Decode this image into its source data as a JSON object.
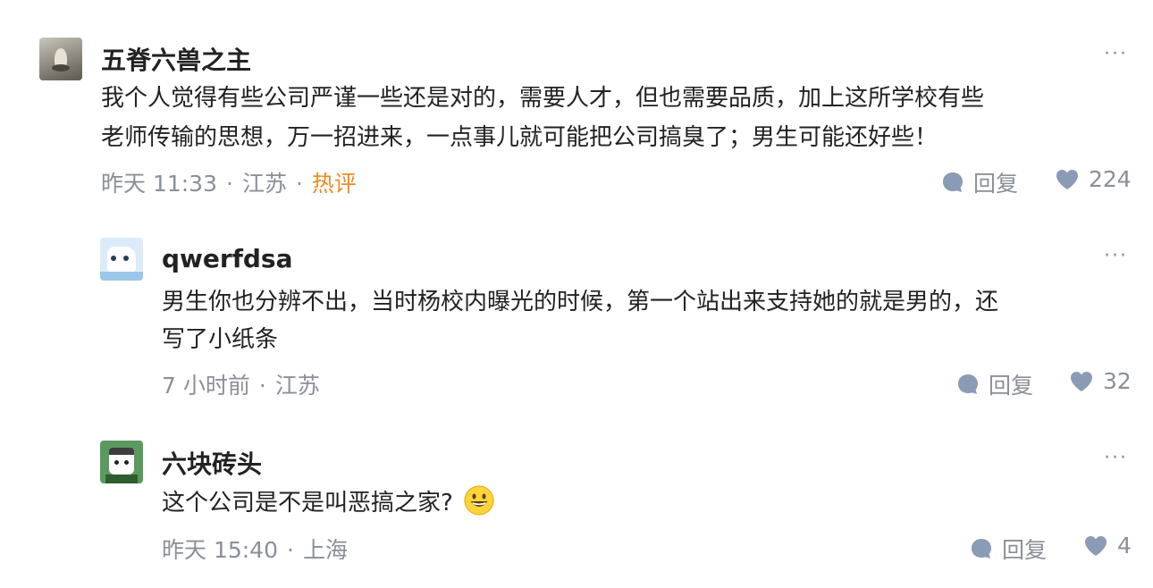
{
  "comments": [
    {
      "user": "五脊六兽之主",
      "text_line1": "我个人觉得有些公司严谨一些还是对的，需要人才，但也需要品质，加上这所学校有些",
      "text_line2": "老师传输的思想，万一招进来，一点事儿就可能把公司搞臭了；男生可能还好些！",
      "time": "昨天 11:33",
      "location": "江苏",
      "badge": "热评",
      "reply_label": "回复",
      "likes": "224",
      "more": "···"
    },
    {
      "user": "qwerfdsa",
      "text_line1": "男生你也分辨不出，当时杨校内曝光的时候，第一个站出来支持她的就是男的，还",
      "text_line2": "写了小纸条",
      "time": "7 小时前",
      "location": "江苏",
      "reply_label": "回复",
      "likes": "32",
      "more": "···"
    },
    {
      "user": "六块砖头",
      "text_line1": "这个公司是不是叫恶搞之家?",
      "emoji": "grinning-face-emoji",
      "time": "昨天 15:40",
      "location": "上海",
      "reply_label": "回复",
      "likes": "4",
      "more": "···"
    }
  ],
  "colors": {
    "hot": "#f08a24",
    "meta": "#8a8f99",
    "icon": "#8a9bb6"
  }
}
